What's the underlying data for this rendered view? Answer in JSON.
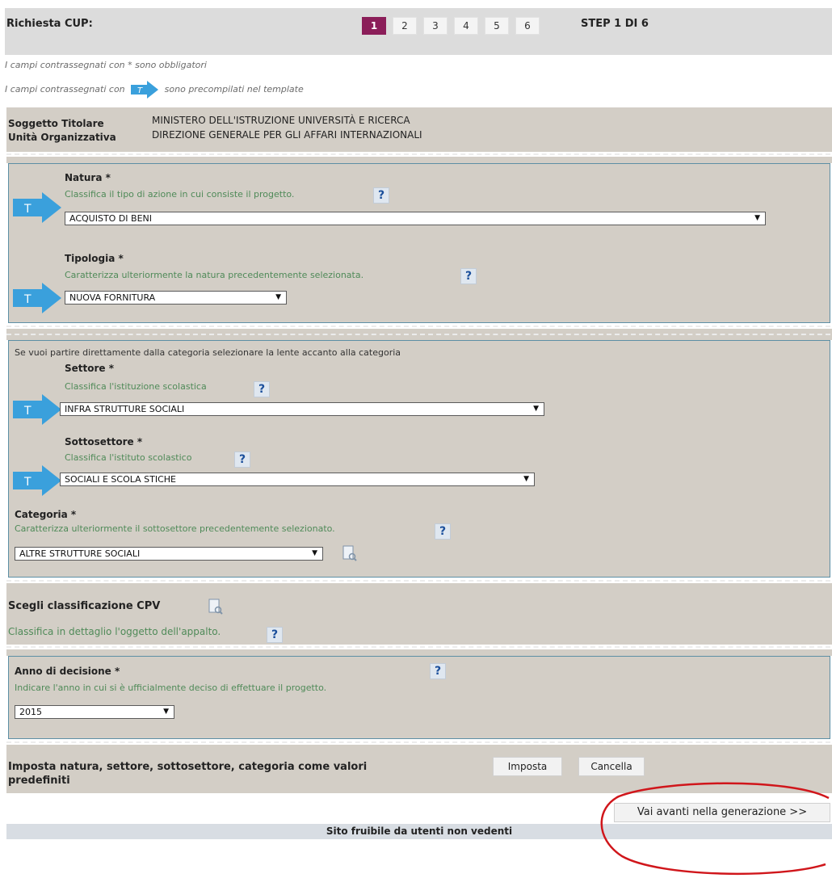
{
  "header": {
    "title": "Richiesta CUP:",
    "steps": [
      "1",
      "2",
      "3",
      "4",
      "5",
      "6"
    ],
    "active_step": "1",
    "step_label": "STEP 1 DI 6"
  },
  "notes": {
    "required": "I campi contrassegnati con * sono obbligatori",
    "template_prefix": "I campi contrassegnati con",
    "template_suffix": "sono precompilati nel template"
  },
  "subject": {
    "titolare_label": "Soggetto Titolare",
    "titolare_value": "MINISTERO DELL'ISTRUZIONE UNIVERSITÀ E RICERCA",
    "unita_label": "Unità Organizzativa",
    "unita_value": "DIREZIONE GENERALE PER GLI AFFARI INTERNAZIONALI"
  },
  "natura": {
    "label": "Natura *",
    "hint": "Classifica il tipo di azione in cui consiste il progetto.",
    "value": "ACQUISTO DI BENI"
  },
  "tipologia": {
    "label": "Tipologia *",
    "hint": "Caratterizza ulteriormente la natura precedentemente selezionata.",
    "value": "NUOVA FORNITURA"
  },
  "category_intro": "Se vuoi partire direttamente dalla categoria selezionare la lente accanto alla categoria",
  "settore": {
    "label": "Settore *",
    "hint": "Classifica l'istituzione scolastica",
    "value": "INFRA STRUTTURE SOCIALI"
  },
  "sottosettore": {
    "label": "Sottosettore *",
    "hint": "Classifica l'istituto scolastico",
    "value": "SOCIALI E SCOLA STICHE"
  },
  "categoria": {
    "label": "Categoria *",
    "hint": "Caratterizza ulteriormente il sottosettore precedentemente selezionato.",
    "value": "ALTRE STRUTTURE SOCIALI"
  },
  "cpv": {
    "label": "Scegli classificazione CPV",
    "hint": "Classifica in dettaglio l'oggetto dell'appalto."
  },
  "anno": {
    "label": "Anno di decisione *",
    "hint": "Indicare l'anno in cui si è ufficialmente deciso di effettuare il progetto.",
    "value": "2015"
  },
  "defaults": {
    "text_line1": "Imposta natura, settore, sottosettore, categoria come valori",
    "text_line2": "predefiniti",
    "imposta": "Imposta",
    "cancella": "Cancella"
  },
  "next_button": "Vai avanti nella generazione >>",
  "footer": "Sito fruibile da utenti non vedenti",
  "glyphs": {
    "help": "?",
    "caret": "▼",
    "template": "T"
  },
  "colors": {
    "accent_step": "#8b1e59",
    "template_arrow": "#3aa0dc",
    "hint_text": "#4f8a58",
    "panel_bg": "#d3cec6",
    "panel_border": "#5d8fa5",
    "annotation_circle": "#d0161b"
  },
  "icons": {
    "template_marker": "blue-arrow-t-icon",
    "help": "question-mark-icon",
    "lens": "document-magnifier-icon",
    "dropdown": "chevron-down-icon"
  }
}
